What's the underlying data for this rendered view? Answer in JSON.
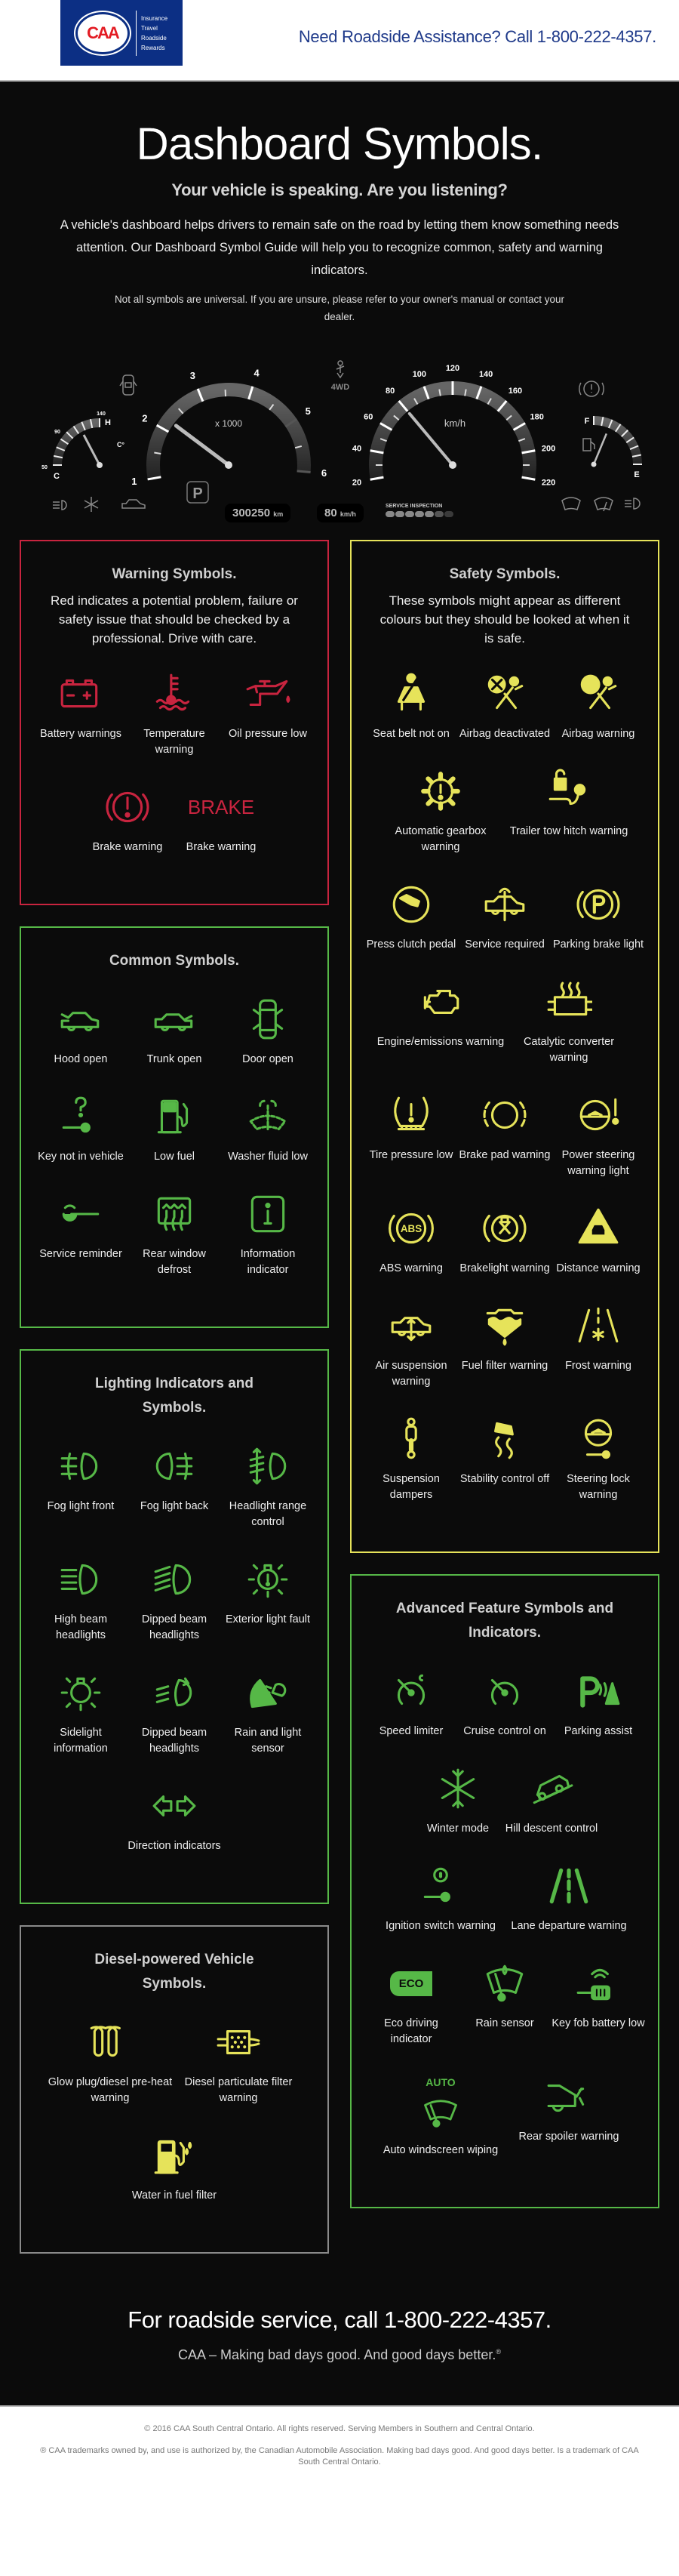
{
  "header": {
    "logo_text": "CAA",
    "logo_services": [
      "Insurance",
      "Travel",
      "Roadside",
      "Rewards"
    ],
    "cta": "Need Roadside Assistance? Call 1-800-222-4357."
  },
  "hero": {
    "title": "Dashboard Symbols.",
    "subtitle": "Your vehicle is speaking. Are you listening?",
    "intro": "A vehicle's dashboard helps drivers to remain safe on the road by letting them know something needs attention. Our Dashboard Symbol Guide will help you to recognize common, safety and warning indicators.",
    "note": "Not all symbols are universal. If you are unsure, please refer to your owner's manual or contact your dealer."
  },
  "dashboard": {
    "temp_gauge": {
      "min_label": "50",
      "mid_label": "90",
      "max_label": "140",
      "low": "C",
      "high": "H",
      "unit": "C°"
    },
    "tachometer": {
      "ticks": [
        "1",
        "2",
        "3",
        "4",
        "5",
        "6"
      ],
      "unit": "x 1000",
      "value": 2.2
    },
    "speedometer": {
      "ticks": [
        "20",
        "40",
        "60",
        "80",
        "100",
        "120",
        "140",
        "160",
        "180",
        "200",
        "220"
      ],
      "unit": "km/h",
      "value": 80
    },
    "fuel_gauge": {
      "full": "F",
      "empty": "E",
      "value": 0.75
    },
    "gear": "P",
    "drive_mode": "4WD",
    "odometer": {
      "value": "300250",
      "unit": "km"
    },
    "speed_readout": {
      "value": "80",
      "unit": "km/h"
    },
    "service_inspection": {
      "label": "SERVICE INSPECTION",
      "segments_total": 7,
      "segments_lit": 5
    }
  },
  "sections": {
    "warning": {
      "title": "Warning Symbols.",
      "desc": "Red indicates a potential problem, failure or safety issue that should be checked by a professional. Drive with care.",
      "color": "#c8243f",
      "items": [
        {
          "icon": "battery-icon",
          "label": "Battery warnings"
        },
        {
          "icon": "temperature-icon",
          "label": "Temperature warning"
        },
        {
          "icon": "oil-can-icon",
          "label": "Oil pressure low"
        },
        {
          "icon": "brake-circle-icon",
          "label": "Brake warning"
        },
        {
          "icon": "brake-text-icon",
          "label": "Brake warning",
          "text": "BRAKE"
        }
      ]
    },
    "common": {
      "title": "Common Symbols.",
      "color": "#56b847",
      "items": [
        {
          "icon": "hood-open-icon",
          "label": "Hood open"
        },
        {
          "icon": "trunk-open-icon",
          "label": "Trunk open"
        },
        {
          "icon": "door-open-icon",
          "label": "Door open"
        },
        {
          "icon": "key-question-icon",
          "label": "Key not in vehicle"
        },
        {
          "icon": "fuel-pump-icon",
          "label": "Low fuel"
        },
        {
          "icon": "washer-fluid-icon",
          "label": "Washer fluid low"
        },
        {
          "icon": "wrench-icon",
          "label": "Service reminder"
        },
        {
          "icon": "rear-defrost-icon",
          "label": "Rear window defrost"
        },
        {
          "icon": "info-icon",
          "label": "Information indicator"
        }
      ]
    },
    "lighting": {
      "title": "Lighting Indicators and Symbols.",
      "color": "#56b847",
      "items": [
        {
          "icon": "fog-front-icon",
          "label": "Fog light front"
        },
        {
          "icon": "fog-back-icon",
          "label": "Fog light back"
        },
        {
          "icon": "headlight-range-icon",
          "label": "Headlight range control"
        },
        {
          "icon": "high-beam-icon",
          "label": "High beam headlights"
        },
        {
          "icon": "dipped-beam-icon",
          "label": "Dipped beam headlights"
        },
        {
          "icon": "exterior-fault-icon",
          "label": "Exterior light fault"
        },
        {
          "icon": "sidelight-icon",
          "label": "Sidelight information"
        },
        {
          "icon": "dipped-beam-auto-icon",
          "label": "Dipped beam headlights"
        },
        {
          "icon": "rain-light-sensor-icon",
          "label": "Rain and light sensor"
        },
        {
          "icon": "direction-arrows-icon",
          "label": "Direction indicators"
        }
      ]
    },
    "diesel": {
      "title": "Diesel-powered Vehicle Symbols.",
      "color": "#e6e35a",
      "items": [
        {
          "icon": "glow-plug-icon",
          "label": "Glow plug/diesel pre-heat warning"
        },
        {
          "icon": "particulate-filter-icon",
          "label": "Diesel particulate filter warning"
        },
        {
          "icon": "water-in-fuel-icon",
          "label": "Water in fuel filter"
        }
      ]
    },
    "safety": {
      "title": "Safety Symbols.",
      "desc": "These symbols might appear as different colours but they should be looked at when it is safe.",
      "color": "#e6e35a",
      "items": [
        {
          "icon": "seatbelt-icon",
          "label": "Seat belt not on"
        },
        {
          "icon": "airbag-off-icon",
          "label": "Airbag deactivated"
        },
        {
          "icon": "airbag-icon",
          "label": "Airbag warning"
        },
        {
          "icon": "gearbox-icon",
          "label": "Automatic gearbox warning"
        },
        {
          "icon": "trailer-hitch-icon",
          "label": "Trailer tow hitch warning"
        },
        {
          "icon": "clutch-icon",
          "label": "Press clutch pedal"
        },
        {
          "icon": "service-car-icon",
          "label": "Service required"
        },
        {
          "icon": "parking-brake-icon",
          "label": "Parking brake light"
        },
        {
          "icon": "engine-icon",
          "label": "Engine/emissions warning"
        },
        {
          "icon": "catalytic-icon",
          "label": "Catalytic converter warning"
        },
        {
          "icon": "tire-pressure-icon",
          "label": "Tire pressure low"
        },
        {
          "icon": "brake-pad-icon",
          "label": "Brake pad warning"
        },
        {
          "icon": "power-steering-icon",
          "label": "Power steering warning light"
        },
        {
          "icon": "abs-icon",
          "label": "ABS warning",
          "text": "ABS"
        },
        {
          "icon": "brakelight-icon",
          "label": "Brakelight warning"
        },
        {
          "icon": "distance-icon",
          "label": "Distance warning"
        },
        {
          "icon": "air-suspension-icon",
          "label": "Air suspension warning"
        },
        {
          "icon": "fuel-filter-icon",
          "label": "Fuel filter warning"
        },
        {
          "icon": "frost-road-icon",
          "label": "Frost warning"
        },
        {
          "icon": "suspension-damper-icon",
          "label": "Suspension dampers"
        },
        {
          "icon": "stability-off-icon",
          "label": "Stability control off"
        },
        {
          "icon": "steering-lock-icon",
          "label": "Steering lock warning"
        }
      ]
    },
    "advanced": {
      "title": "Advanced Feature Symbols and Indicators.",
      "color": "#56b847",
      "items": [
        {
          "icon": "speed-limiter-icon",
          "label": "Speed limiter"
        },
        {
          "icon": "cruise-control-icon",
          "label": "Cruise control on"
        },
        {
          "icon": "parking-assist-icon",
          "label": "Parking assist"
        },
        {
          "icon": "winter-mode-icon",
          "label": "Winter mode"
        },
        {
          "icon": "hill-descent-icon",
          "label": "Hill descent control"
        },
        {
          "icon": "ignition-switch-icon",
          "label": "Ignition switch warning"
        },
        {
          "icon": "lane-departure-icon",
          "label": "Lane departure warning"
        },
        {
          "icon": "eco-icon",
          "label": "Eco driving indicator",
          "text": "ECO"
        },
        {
          "icon": "rain-sensor-icon",
          "label": "Rain sensor"
        },
        {
          "icon": "key-fob-battery-icon",
          "label": "Key fob battery low"
        },
        {
          "icon": "auto-wiper-icon",
          "label": "Auto windscreen wiping",
          "text": "AUTO"
        },
        {
          "icon": "rear-spoiler-icon",
          "label": "Rear spoiler warning"
        }
      ]
    }
  },
  "footer": {
    "cta": "For roadside service, call 1-800-222-4357.",
    "tagline": "CAA – Making bad days good. And good days better.",
    "tagline_mark": "®",
    "copyright": "© 2016 CAA South Central Ontario. All rights reserved. Serving Members in Southern and Central Ontario.",
    "trademark": "® CAA trademarks owned by, and use is authorized by, the Canadian Automobile Association. Making bad days good. And good days better. Is a trademark of CAA South Central Ontario."
  }
}
